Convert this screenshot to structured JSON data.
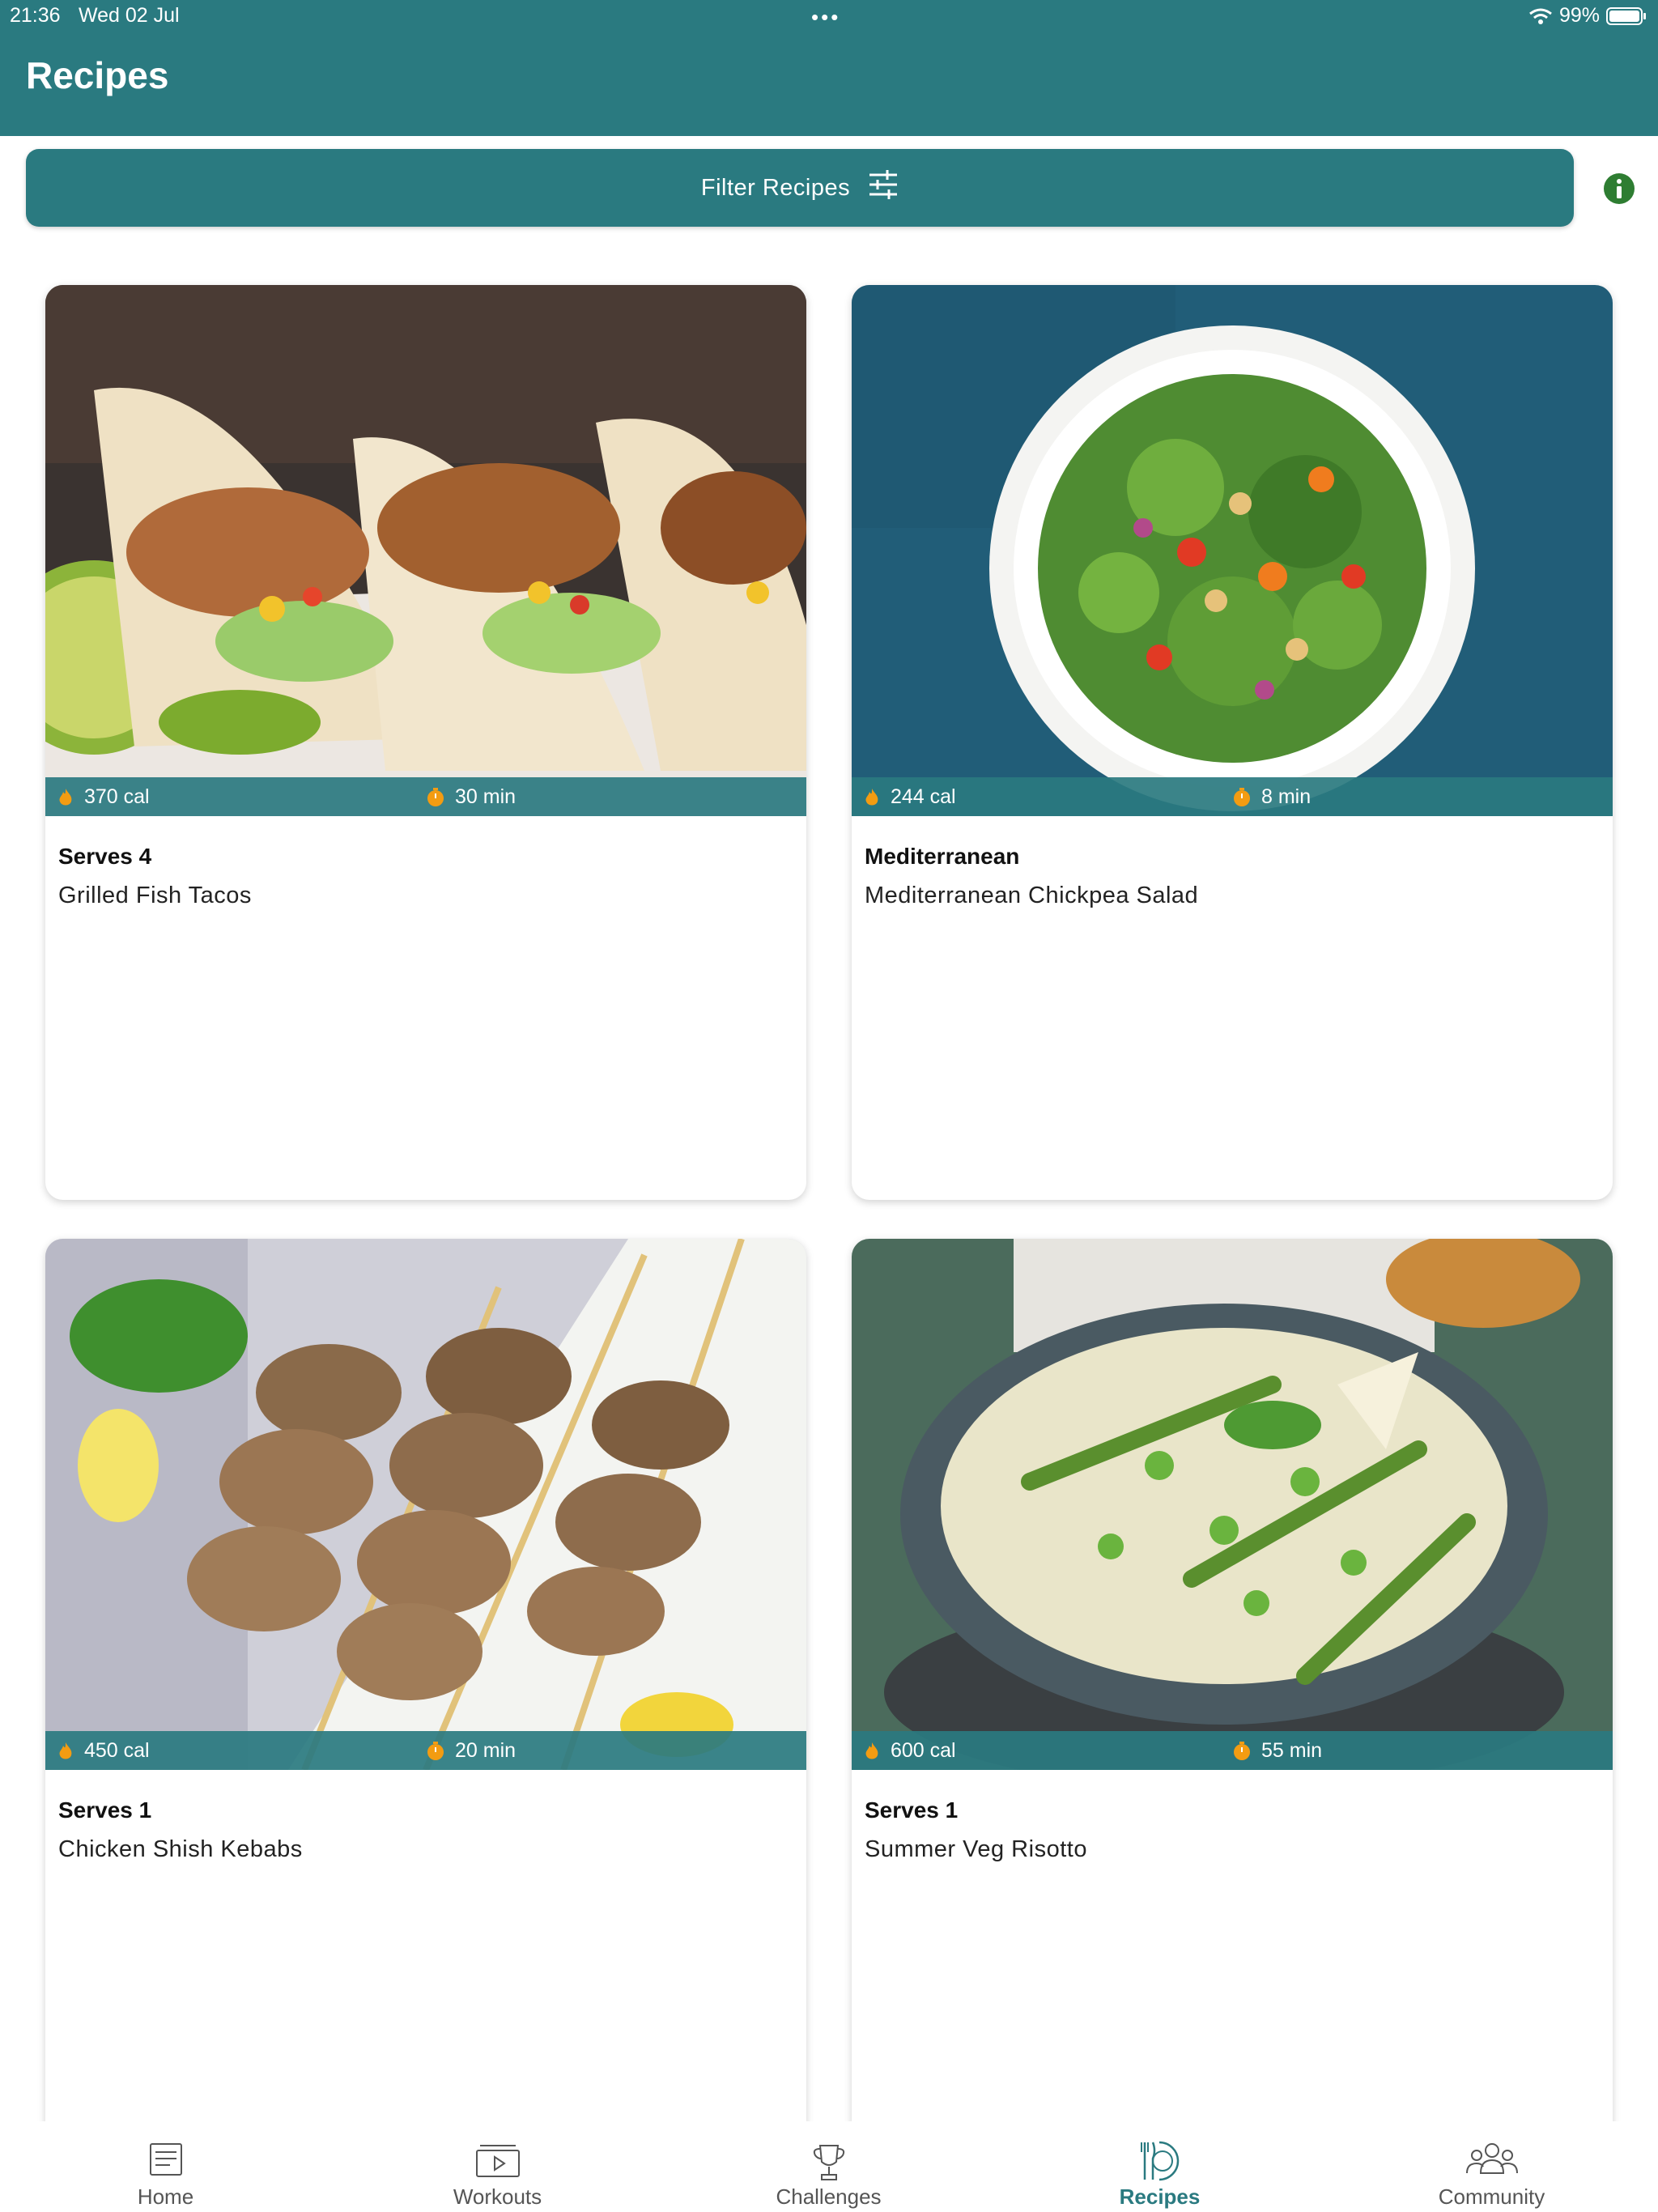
{
  "status_bar": {
    "time": "21:36",
    "date": "Wed 02 Jul",
    "battery": "99%"
  },
  "header": {
    "title": "Recipes"
  },
  "filter": {
    "label": "Filter Recipes",
    "icon": "sliders-icon"
  },
  "info_icon": "info-icon",
  "colors": {
    "primary": "#2a7a80",
    "accent": "#f39c12",
    "info": "#2e7d32"
  },
  "recipes": [
    {
      "calories": "370 cal",
      "time": "30 min",
      "serves": "Serves 4",
      "name": "Grilled Fish Tacos"
    },
    {
      "calories": "244 cal",
      "time": "8 min",
      "serves": "Mediterranean",
      "name": "Mediterranean Chickpea Salad"
    },
    {
      "calories": "450 cal",
      "time": "20 min",
      "serves": "Serves 1",
      "name": "Chicken Shish Kebabs"
    },
    {
      "calories": "600 cal",
      "time": "55 min",
      "serves": "Serves 1",
      "name": "Summer Veg Risotto"
    }
  ],
  "tabs": [
    {
      "label": "Home",
      "icon": "home-icon"
    },
    {
      "label": "Workouts",
      "icon": "workouts-icon"
    },
    {
      "label": "Challenges",
      "icon": "trophy-icon"
    },
    {
      "label": "Recipes",
      "icon": "recipes-icon",
      "active": true
    },
    {
      "label": "Community",
      "icon": "community-icon"
    }
  ]
}
